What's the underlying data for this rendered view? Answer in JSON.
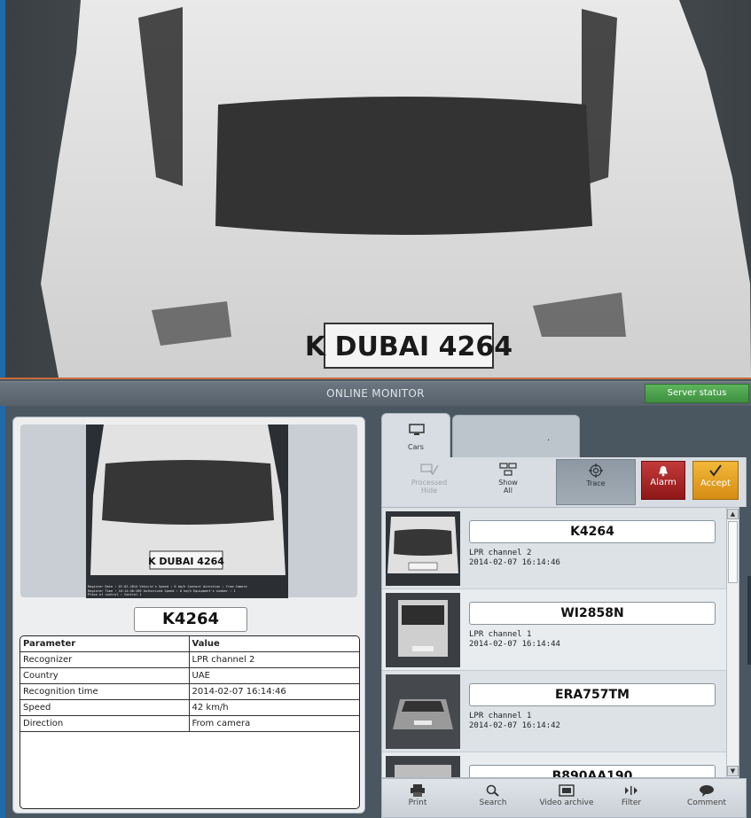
{
  "camera": {
    "plate_text": "K DUBAI 4264"
  },
  "monitor": {
    "title": "ONLINE MONITOR",
    "server_status_label": "Server status"
  },
  "detail": {
    "plate": "K4264",
    "photo_plate": "K DUBAI 4264",
    "photo_caption": [
      "Register Date : 07-02-2014    Vehicle's Speed : 0 km/h Contact direction : from Camera",
      "Register Time : 16:14:46:209  Authorized Speed : 0 km/h    Equipment's number : 1",
      "Place of control : Control 1"
    ],
    "table": {
      "headers": [
        "Parameter",
        "Value"
      ],
      "rows": [
        [
          "Recognizer",
          "LPR channel 2"
        ],
        [
          "Country",
          "UAE"
        ],
        [
          "Recognition time",
          "2014-02-07 16:14:46"
        ],
        [
          "Speed",
          "42 km/h"
        ],
        [
          "Direction",
          "From camera"
        ]
      ]
    }
  },
  "tabs": [
    {
      "label": "Cars",
      "icon": "monitor-icon"
    },
    {
      "label": ".",
      "icon": ""
    }
  ],
  "toolbar": {
    "processed_label_1": "Processed",
    "processed_label_2": "Hide",
    "show_label_1": "Show",
    "show_label_2": "All",
    "trace_label": "Trace",
    "alarm_label": "Alarm",
    "accept_label": "Accept"
  },
  "list": [
    {
      "plate": "K4264",
      "channel": "LPR channel 2",
      "time": "2014-02-07 16:14:46"
    },
    {
      "plate": "WI2858N",
      "channel": "LPR channel 1",
      "time": "2014-02-07 16:14:44"
    },
    {
      "plate": "ERA757TM",
      "channel": "LPR channel 1",
      "time": "2014-02-07 16:14:42"
    },
    {
      "plate": "B890AA190",
      "channel": "",
      "time": ""
    }
  ],
  "bottom": {
    "print": "Print",
    "search": "Search",
    "video_archive": "Video archive",
    "filter": "Filter",
    "comment": "Comment"
  },
  "colors": {
    "server_status": "#4aa34a",
    "alarm": "#a82323",
    "accept": "#e6a424",
    "camera_border": "#c86a3a",
    "side_strip": "#1f6aa8"
  }
}
